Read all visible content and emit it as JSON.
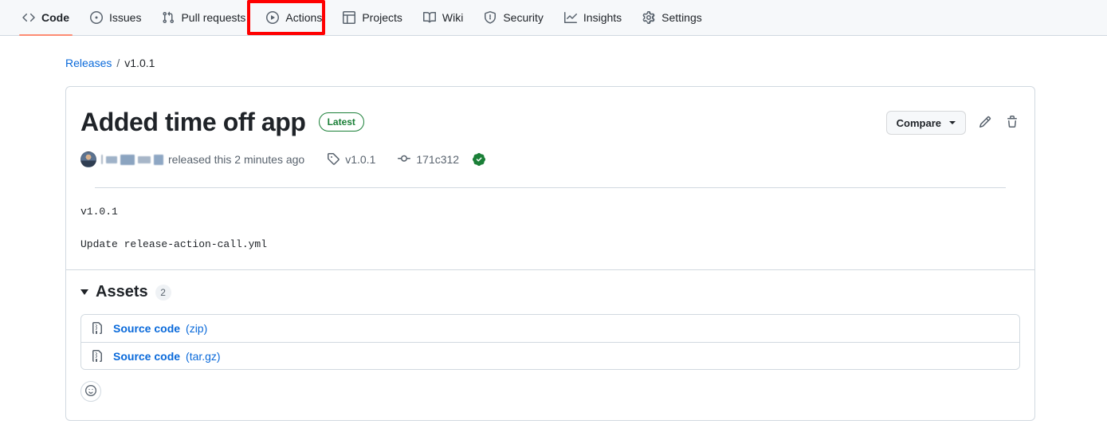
{
  "nav": {
    "items": [
      {
        "label": "Code",
        "icon": "code-icon",
        "active": true,
        "highlighted": false
      },
      {
        "label": "Issues",
        "icon": "issue-icon",
        "active": false,
        "highlighted": false
      },
      {
        "label": "Pull requests",
        "icon": "git-pull-request-icon",
        "active": false,
        "highlighted": false
      },
      {
        "label": "Actions",
        "icon": "play-icon",
        "active": false,
        "highlighted": true
      },
      {
        "label": "Projects",
        "icon": "table-icon",
        "active": false,
        "highlighted": false
      },
      {
        "label": "Wiki",
        "icon": "book-icon",
        "active": false,
        "highlighted": false
      },
      {
        "label": "Security",
        "icon": "shield-icon",
        "active": false,
        "highlighted": false
      },
      {
        "label": "Insights",
        "icon": "graph-icon",
        "active": false,
        "highlighted": false
      },
      {
        "label": "Settings",
        "icon": "gear-icon",
        "active": false,
        "highlighted": false
      }
    ],
    "active_underline_color": "#fd8c73",
    "highlight_color": "#ff0000"
  },
  "breadcrumb": {
    "parent": "Releases",
    "separator": "/",
    "current": "v1.0.1"
  },
  "release": {
    "title": "Added time off app",
    "badge": "Latest",
    "badge_color": "#1a7f37",
    "meta": {
      "author_redacted": true,
      "released_text": "released this 2 minutes ago",
      "tag": "v1.0.1",
      "tag_icon": "tag-icon",
      "commit": "171c312",
      "commit_icon": "commit-icon",
      "verified_icon": "verified-check-icon"
    },
    "actions": {
      "compare_label": "Compare",
      "edit_icon": "pencil-icon",
      "delete_icon": "trash-icon"
    },
    "body": [
      "v1.0.1",
      "Update release-action-call.yml"
    ]
  },
  "assets": {
    "title": "Assets",
    "count": "2",
    "expanded": true,
    "items": [
      {
        "name": "Source code",
        "kind": "(zip)",
        "icon": "file-zip-icon"
      },
      {
        "name": "Source code",
        "kind": "(tar.gz)",
        "icon": "file-zip-icon"
      }
    ]
  },
  "reactions": {
    "add_icon": "smiley-icon"
  }
}
